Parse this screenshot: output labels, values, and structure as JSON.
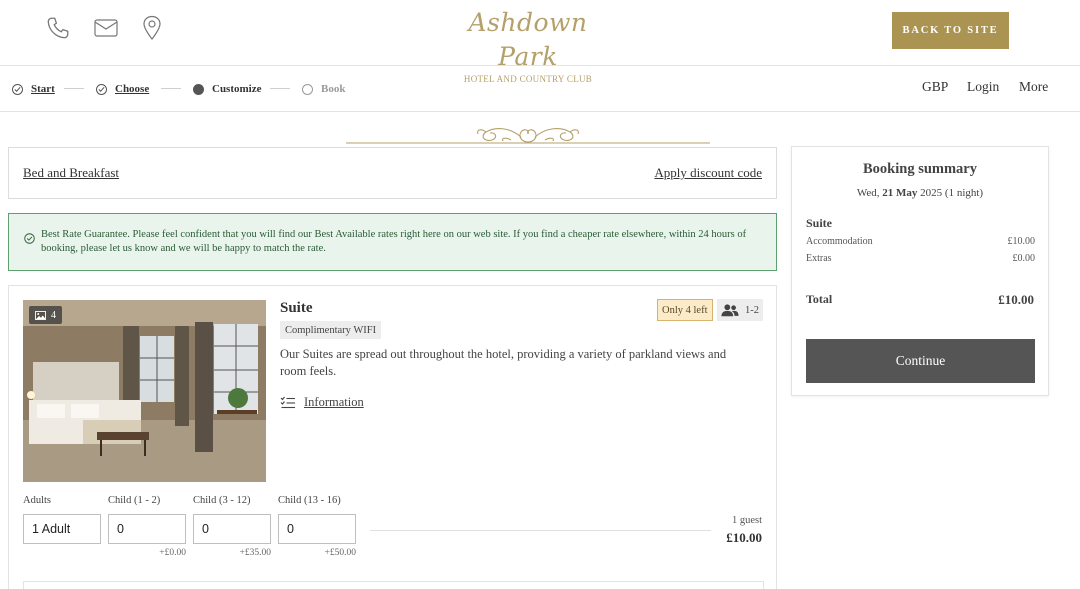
{
  "header": {
    "icons": [
      "phone-icon",
      "mail-icon",
      "map-pin-icon"
    ],
    "logo_main": "Ashdown Park",
    "logo_sub": "HOTEL AND COUNTRY CLUB",
    "back_button": "BACK TO SITE",
    "accent_color": "#ab9452"
  },
  "steps": {
    "items": [
      {
        "label": "Start",
        "state": "done"
      },
      {
        "label": "Choose",
        "state": "done"
      },
      {
        "label": "Customize",
        "state": "current"
      },
      {
        "label": "Book",
        "state": "upcoming"
      }
    ]
  },
  "nav": {
    "currency": "GBP",
    "login": "Login",
    "more": "More"
  },
  "rate": {
    "name": "Bed and Breakfast",
    "discount_link": "Apply discount code"
  },
  "guarantee": {
    "text": "Best Rate Guarantee. Please feel confident that you will find our Best Available rates right here on our web site. If you find a cheaper rate elsewhere, within 24 hours of booking, please let us know and we will be happy to match the rate."
  },
  "room": {
    "photo_count": "4",
    "title": "Suite",
    "amenity": "Complimentary WIFI",
    "availability": "Only 4 left",
    "occupancy": "1-2",
    "description": "Our Suites are spread out throughout the hotel, providing a variety of parkland views and room feels.",
    "info_link": "Information",
    "guests": [
      {
        "label": "Adults",
        "value": "1 Adult",
        "price": ""
      },
      {
        "label": "Child (1 - 2)",
        "value": "0",
        "price": "+£0.00"
      },
      {
        "label": "Child (3 - 12)",
        "value": "0",
        "price": "+£35.00"
      },
      {
        "label": "Child (13 - 16)",
        "value": "0",
        "price": "+£50.00"
      }
    ],
    "guest_count": "1 guest",
    "price": "£10.00"
  },
  "summary": {
    "title": "Booking summary",
    "date_prefix": "Wed,",
    "date_bold": "21 May",
    "date_suffix": "2025 (1 night)",
    "room_name": "Suite",
    "lines": [
      {
        "label": "Accommodation",
        "value": "£10.00"
      },
      {
        "label": "Extras",
        "value": "£0.00"
      }
    ],
    "total_label": "Total",
    "total_value": "£10.00",
    "continue_button": "Continue"
  }
}
